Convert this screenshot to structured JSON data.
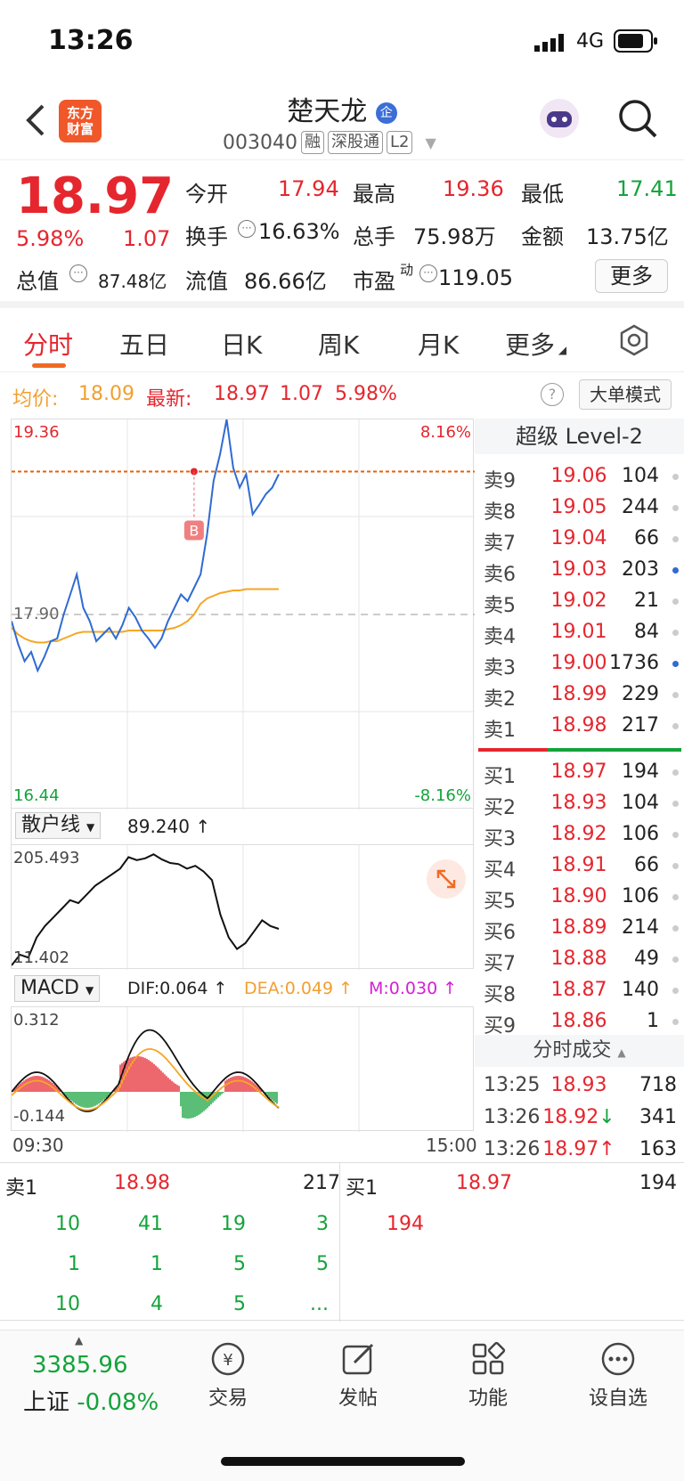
{
  "status": {
    "time": "13:26",
    "network": "4G"
  },
  "header": {
    "logo_text": "东方财富",
    "title": "楚天龙",
    "code": "003040",
    "tags": [
      "融",
      "深股通",
      "L2"
    ]
  },
  "quote": {
    "price": "18.97",
    "change_pct": "5.98%",
    "change": "1.07",
    "open_label": "今开",
    "open": "17.94",
    "high_label": "最高",
    "high": "19.36",
    "low_label": "最低",
    "low": "17.41",
    "turnover_label": "换手",
    "turnover": "16.63%",
    "volume_label": "总手",
    "volume": "75.98万",
    "amount_label": "金额",
    "amount": "13.75亿",
    "total_mv_label": "总值",
    "total_mv": "87.48亿",
    "float_mv_label": "流值",
    "float_mv": "86.66亿",
    "pe_label": "市盈",
    "pe_sup": "动",
    "pe": "119.05",
    "more_label": "更多"
  },
  "tabs": [
    "分时",
    "五日",
    "日K",
    "周K",
    "月K",
    "更多"
  ],
  "info": {
    "avg_label": "均价:",
    "avg": "18.09",
    "latest_label": "最新:",
    "latest": "18.97",
    "latest_change": "1.07",
    "latest_pct": "5.98%",
    "mode_label": "大单模式"
  },
  "chart_data": {
    "type": "line",
    "y_top": "19.36",
    "y_mid": "17.90",
    "y_bottom": "16.44",
    "pct_top": "8.16%",
    "pct_bottom": "-8.16%",
    "ylim": [
      16.44,
      19.36
    ],
    "prev_close": 17.9,
    "latest": 18.97,
    "marker": "B",
    "price_series": [
      17.85,
      17.68,
      17.55,
      17.62,
      17.48,
      17.58,
      17.7,
      17.72,
      17.9,
      18.05,
      18.2,
      17.95,
      17.85,
      17.7,
      17.75,
      17.8,
      17.72,
      17.82,
      17.95,
      17.88,
      17.78,
      17.72,
      17.65,
      17.72,
      17.85,
      17.95,
      18.05,
      18.0,
      18.1,
      18.2,
      18.5,
      18.9,
      19.1,
      19.36,
      19.0,
      18.85,
      18.95,
      18.65,
      18.72,
      18.8,
      18.85,
      18.95
    ],
    "avg_series": [
      17.8,
      17.75,
      17.72,
      17.7,
      17.69,
      17.69,
      17.7,
      17.7,
      17.72,
      17.74,
      17.76,
      17.77,
      17.77,
      17.77,
      17.77,
      17.77,
      17.77,
      17.77,
      17.78,
      17.78,
      17.78,
      17.78,
      17.78,
      17.78,
      17.79,
      17.8,
      17.82,
      17.85,
      17.9,
      17.98,
      18.02,
      18.04,
      18.06,
      18.07,
      18.08,
      18.08,
      18.09,
      18.09,
      18.09,
      18.09,
      18.09,
      18.09
    ]
  },
  "retail": {
    "label": "散户线",
    "value": "89.240",
    "top": "205.493",
    "bottom": "11.402",
    "series": [
      11.4,
      30,
      25,
      60,
      80,
      95,
      110,
      125,
      120,
      135,
      150,
      160,
      170,
      180,
      200,
      195,
      198,
      205,
      196,
      190,
      188,
      180,
      185,
      175,
      160,
      100,
      60,
      40,
      50,
      70,
      90,
      80,
      75
    ]
  },
  "macd": {
    "label": "MACD",
    "dif": "DIF:0.064",
    "dea": "DEA:0.049",
    "m": "M:0.030",
    "top": "0.312",
    "bottom": "-0.144",
    "time_start": "09:30",
    "time_end": "15:00"
  },
  "book": {
    "title": "超级 Level-2",
    "asks": [
      {
        "name": "卖9",
        "price": "19.06",
        "vol": "104"
      },
      {
        "name": "卖8",
        "price": "19.05",
        "vol": "244"
      },
      {
        "name": "卖7",
        "price": "19.04",
        "vol": "66"
      },
      {
        "name": "卖6",
        "price": "19.03",
        "vol": "203"
      },
      {
        "name": "卖5",
        "price": "19.02",
        "vol": "21"
      },
      {
        "name": "卖4",
        "price": "19.01",
        "vol": "84"
      },
      {
        "name": "卖3",
        "price": "19.00",
        "vol": "1736"
      },
      {
        "name": "卖2",
        "price": "18.99",
        "vol": "229"
      },
      {
        "name": "卖1",
        "price": "18.98",
        "vol": "217"
      }
    ],
    "bids": [
      {
        "name": "买1",
        "price": "18.97",
        "vol": "194"
      },
      {
        "name": "买2",
        "price": "18.93",
        "vol": "104"
      },
      {
        "name": "买3",
        "price": "18.92",
        "vol": "106"
      },
      {
        "name": "买4",
        "price": "18.91",
        "vol": "66"
      },
      {
        "name": "买5",
        "price": "18.90",
        "vol": "106"
      },
      {
        "name": "买6",
        "price": "18.89",
        "vol": "214"
      },
      {
        "name": "买7",
        "price": "18.88",
        "vol": "49"
      },
      {
        "name": "买8",
        "price": "18.87",
        "vol": "140"
      },
      {
        "name": "买9",
        "price": "18.86",
        "vol": "1"
      }
    ],
    "trades_title": "分时成交",
    "trades": [
      {
        "time": "13:25",
        "price": "18.93",
        "vol": "718"
      },
      {
        "time": "13:26",
        "price": "18.92↓",
        "vol": "341"
      },
      {
        "time": "13:26",
        "price": "18.97↑",
        "vol": "163"
      }
    ]
  },
  "level": {
    "sell_label": "卖1",
    "sell_price": "18.98",
    "sell_vol": "217",
    "buy_label": "买1",
    "buy_price": "18.97",
    "buy_vol": "194",
    "sell_queue": [
      [
        "10",
        "41",
        "19",
        "3"
      ],
      [
        "1",
        "1",
        "5",
        "5"
      ],
      [
        "10",
        "4",
        "5",
        "..."
      ]
    ],
    "buy_queue": [
      "194"
    ]
  },
  "nav": {
    "index_value": "3385.96",
    "index_name": "上证",
    "index_change": "-0.08%",
    "items": [
      "交易",
      "发帖",
      "功能",
      "设自选"
    ]
  }
}
